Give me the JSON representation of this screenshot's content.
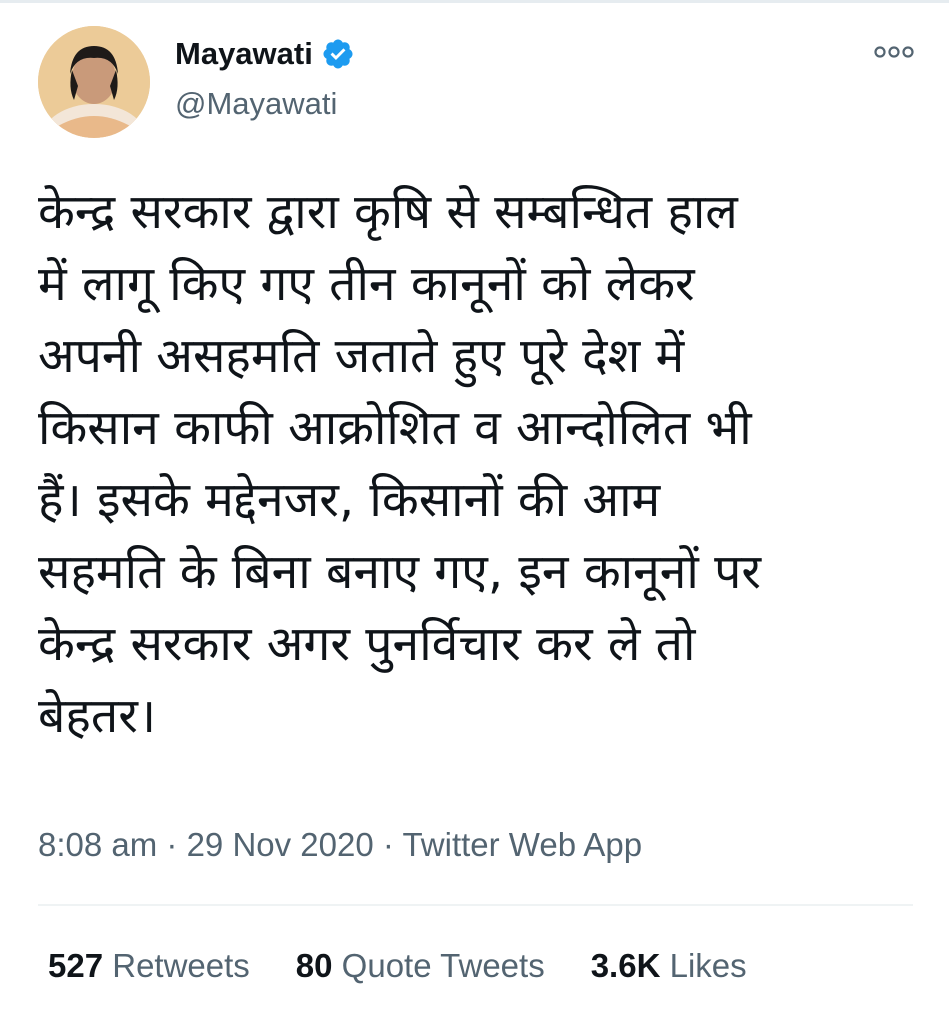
{
  "tweet": {
    "author": {
      "display_name": "Mayawati",
      "handle": "@Mayawati",
      "verified": true
    },
    "text_lines": [
      "केन्द्र सरकार द्वारा कृषि से सम्बन्धित हाल",
      "में लागू किए गए तीन कानूनों को लेकर",
      "अपनी असहमति जताते हुए पूरे देश में",
      "किसान काफी आक्रोशित व आन्दोलित भी",
      "हैं। इसके मद्देनजर, किसानों की आम",
      "सहमति के बिना बनाए गए, इन कानूनों पर",
      "केन्द्र सरकार अगर पुनर्विचार कर ले तो",
      "बेहतर।"
    ],
    "meta": {
      "time": "8:08 am",
      "separator": " · ",
      "date": "29 Nov 2020",
      "source": "Twitter Web App"
    },
    "stats": {
      "retweets_count": "527",
      "retweets_label": " Retweets",
      "quotes_count": "80",
      "quotes_label": " Quote Tweets",
      "likes_count": "3.6K",
      "likes_label": " Likes"
    }
  },
  "icons": {
    "verified": "verified-badge-icon",
    "more": "more-options-icon"
  },
  "colors": {
    "verified": "#1d9bf0",
    "secondary_text": "#536471",
    "primary_text": "#0f1419",
    "divider": "#eff3f4"
  }
}
